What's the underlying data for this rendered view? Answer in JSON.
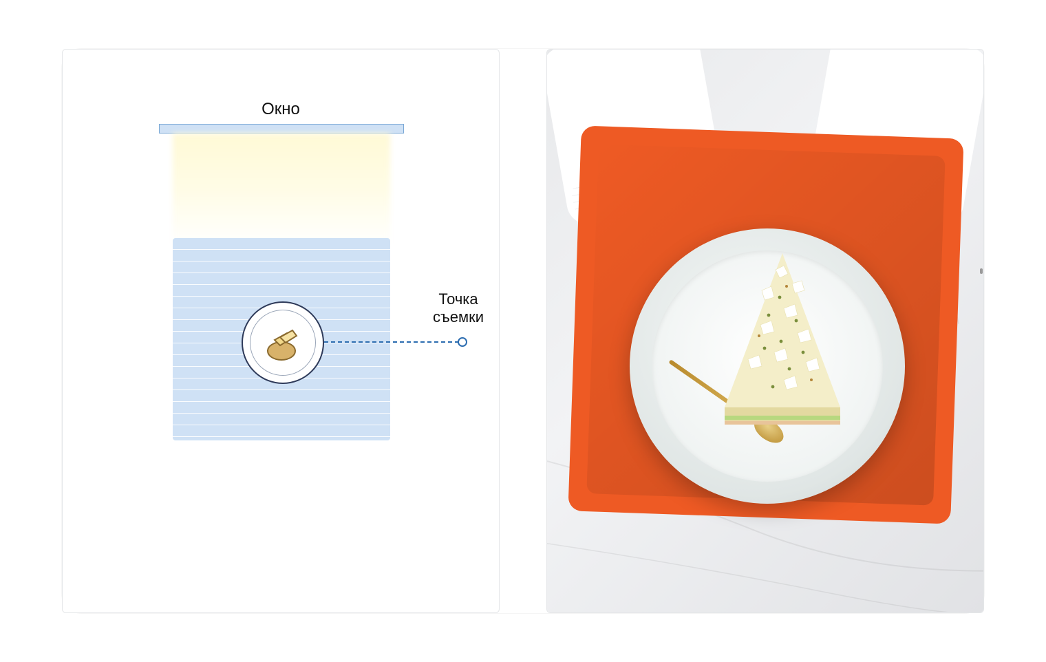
{
  "diagram": {
    "window_label": "Окно",
    "camera_label_line1": "Точка",
    "camera_label_line2": "съемки"
  },
  "colors": {
    "window_fill": "#cfe1f5",
    "window_stroke": "#7ba9d6",
    "table_fill": "#cfe1f5",
    "camera_dash": "#2b6cb0",
    "napkin": "#ee5a24",
    "spoon": "#c69a3a"
  }
}
